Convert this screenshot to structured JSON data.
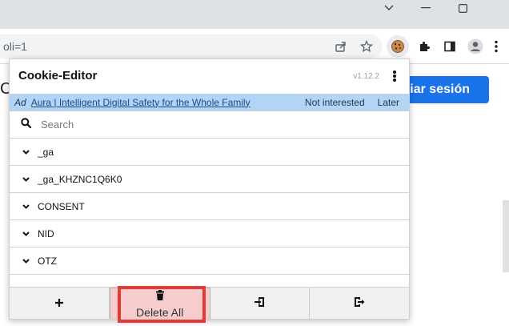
{
  "browser": {
    "url_fragment": "oli=1",
    "window_controls": [
      "chevron-down-icon",
      "minimize-icon",
      "maximize-icon"
    ]
  },
  "page": {
    "login_button": "ciar sesión",
    "partial_text": "C"
  },
  "popup": {
    "title": "Cookie-Editor",
    "version": "v1.12.2",
    "ad": {
      "tag": "Ad",
      "link_text": "Aura | Intelligent Digital Safety for the Whole Family",
      "not_interested": "Not interested",
      "later": "Later"
    },
    "search": {
      "placeholder": "Search",
      "value": ""
    },
    "cookies": [
      {
        "name": "_ga"
      },
      {
        "name": "_ga_KHZNC1Q6K0"
      },
      {
        "name": "CONSENT"
      },
      {
        "name": "NID"
      },
      {
        "name": "OTZ"
      }
    ],
    "bottom_bar": {
      "add_icon": "plus-icon",
      "delete_label": "Delete All",
      "delete_icon": "trash-icon",
      "import_icon": "import-icon",
      "export_icon": "export-icon"
    }
  },
  "colors": {
    "ad_background": "#b3d4f5",
    "delete_button_bg": "#f6cccc",
    "highlight": "#e53935",
    "login_button": "#1a73e8"
  }
}
